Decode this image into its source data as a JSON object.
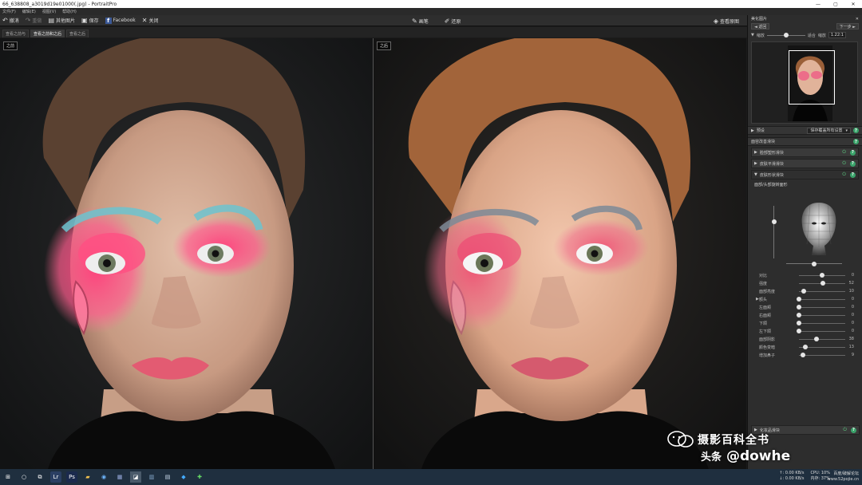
{
  "window": {
    "title": "66_638808_a3019d19e01000(.jpg) - PortraitPro",
    "controls": [
      "—",
      "▢",
      "✕"
    ]
  },
  "menu": [
    "文件(F)",
    "编辑(E)",
    "视图(V)",
    "帮助(H)"
  ],
  "toolbar": {
    "undo": "撤消",
    "redo": "重做",
    "open": "其他图片",
    "save": "保存",
    "facebook": "Facebook",
    "close": "关闭",
    "mask": "画笔",
    "restore": "还原",
    "compare": "查看原图"
  },
  "view_tabs": [
    "查看之前与",
    "查看之前和之后",
    "查看之后"
  ],
  "view_tab_active": 1,
  "panes": {
    "before_label": "之前",
    "after_label": "之后"
  },
  "right_panel": {
    "header": "美化图片",
    "prev": "◄ 返回",
    "next": "下一步 ►",
    "zoom_label": "缩放",
    "fit_label": "适合",
    "zoom_value": "1.22:1",
    "zoom_prefix": "缩放",
    "zoom_level": 0.5,
    "preset_label": "预设",
    "preset_value": "保存覆盖所有设置",
    "section_title": "面容改善滑块",
    "groups": [
      "脸部塑形滑块",
      "皮肤平滑滑块",
      "皮肤形状滑块"
    ],
    "shape_group_title": "皮肤形状滑块",
    "shape_label": "面部/头部旋转面形",
    "rotation_vertical": 0.3,
    "rotation_horizontal": 0.5,
    "sliders": [
      {
        "label": "对比",
        "value": "0",
        "level": 0.5,
        "arrow": false
      },
      {
        "label": "强度",
        "value": "52",
        "level": 0.52,
        "arrow": false
      },
      {
        "label": "面部亮度",
        "value": "10",
        "level": 0.1,
        "arrow": false
      },
      {
        "label": "额头",
        "value": "0",
        "level": 0.0,
        "arrow": true
      },
      {
        "label": "左面颊",
        "value": "0",
        "level": 0.0,
        "arrow": false
      },
      {
        "label": "右面颊",
        "value": "0",
        "level": 0.0,
        "arrow": false
      },
      {
        "label": "下颌",
        "value": "0",
        "level": 0.0,
        "arrow": false
      },
      {
        "label": "左下颌",
        "value": "0",
        "level": 0.0,
        "arrow": false
      },
      {
        "label": "面部阴影",
        "value": "38",
        "level": 0.38,
        "arrow": false
      },
      {
        "label": "颜色变暗",
        "value": "13",
        "level": 0.13,
        "arrow": false
      },
      {
        "label": "增加鼻子",
        "value": "9",
        "level": 0.09,
        "arrow": false
      }
    ],
    "bottom_group": "化妆品滑块"
  },
  "taskbar": {
    "net_up": "↑: 0.00 KB/s",
    "net_down": "↓: 0.00 KB/s",
    "cpu": "CPU: 10%",
    "mem": "内存: 37%",
    "time": "百度/破解论坛",
    "date": "www.52pojie.cn"
  },
  "watermark": {
    "line1": "摄影百科全书",
    "line2a": "头条",
    "line2b": "@dowhe",
    "small": "百度/破解论坛"
  },
  "colors": {
    "accent_green": "#3aa36a",
    "titlebar": "#ffffff",
    "panel": "#2d2d2d",
    "taskbar": "#1f2f3f"
  }
}
